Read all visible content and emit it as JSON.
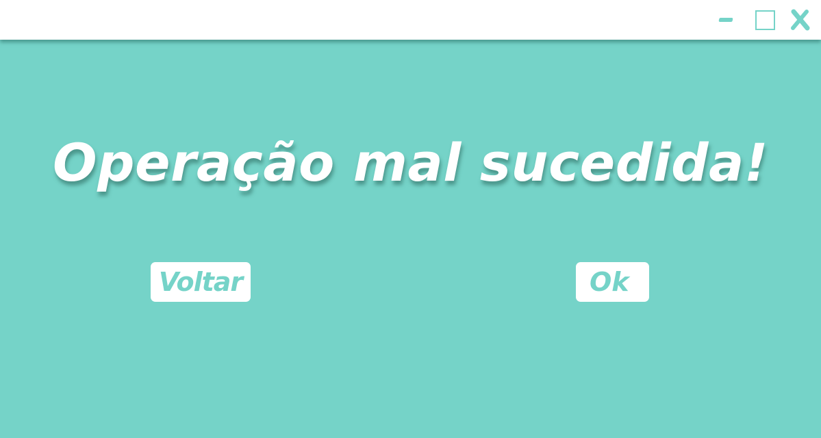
{
  "window": {
    "controls": {
      "minimize_icon": "minimize-icon",
      "maximize_icon": "maximize-icon",
      "close_icon": "close-icon"
    }
  },
  "dialog": {
    "message": "Operação mal sucedida!",
    "back_label": "Voltar",
    "ok_label": "Ok"
  },
  "colors": {
    "background": "#75d3c8",
    "titlebar": "#ffffff",
    "text": "#ffffff",
    "button_bg": "#ffffff",
    "button_text": "#75d3c8"
  }
}
